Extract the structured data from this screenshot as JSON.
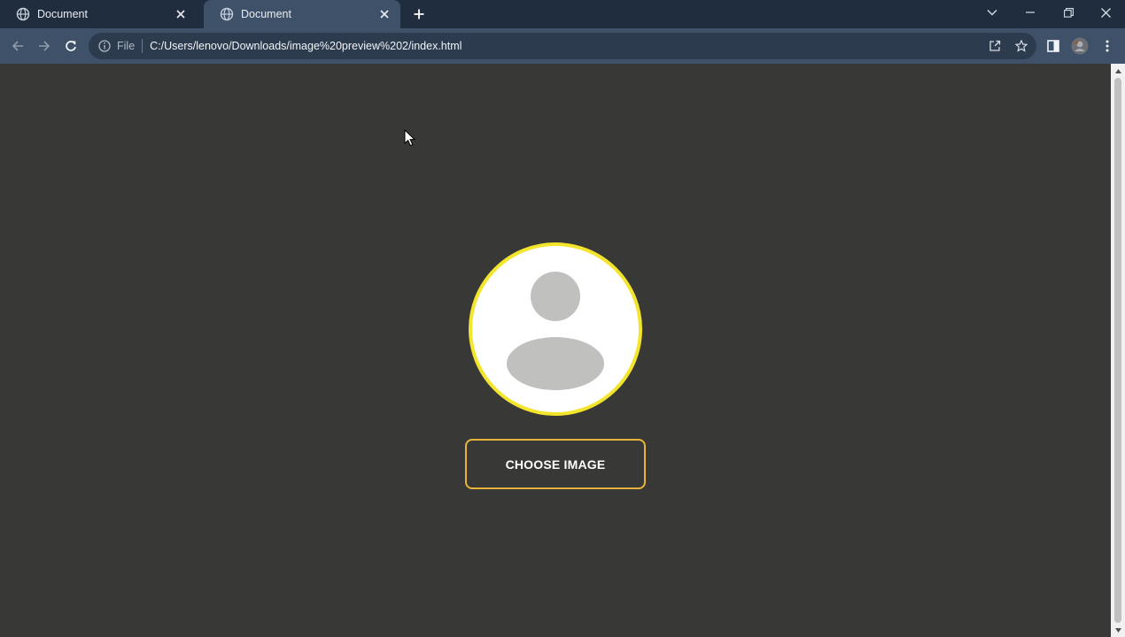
{
  "tabs": [
    {
      "title": "Document",
      "icon": "globe-icon",
      "active": false
    },
    {
      "title": "Document",
      "icon": "globe-icon",
      "active": true
    }
  ],
  "toolbar": {
    "scheme_label": "File",
    "url": "C:/Users/lenovo/Downloads/image%20preview%202/index.html"
  },
  "page": {
    "choose_button_label": "CHOOSE IMAGE",
    "avatar_icon": "user-silhouette-icon"
  },
  "colors": {
    "page_background": "#383936",
    "tabstrip": "#1f2d3e",
    "toolbar": "#3e5169",
    "avatar_ring": "#f3e52b",
    "button_border": "#e7b43b"
  }
}
